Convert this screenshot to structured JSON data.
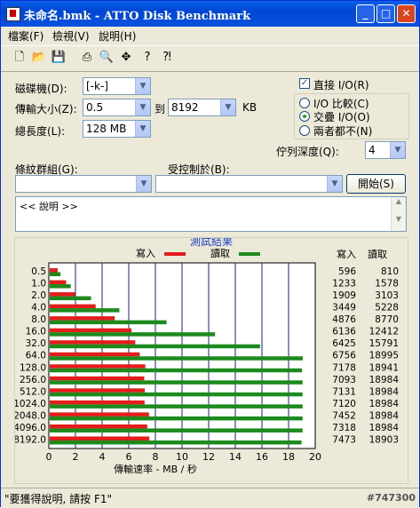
{
  "window": {
    "title": "未命名.bmk - ATTO Disk Benchmark",
    "minimize": "_",
    "maximize": "□",
    "close": "✕"
  },
  "menu": [
    "檔案(F)",
    "檢視(V)",
    "說明(H)"
  ],
  "toolbar": [
    "new-file-icon",
    "open-folder-icon",
    "save-icon",
    "print-icon",
    "print-preview-icon",
    "move-icon",
    "help-icon",
    "context-help-icon"
  ],
  "form": {
    "drive_label": "磁碟機(D):",
    "drive_value": "[-k-]",
    "transfer_label": "傳輸大小(Z):",
    "transfer_from": "0.5",
    "to_label": "到",
    "transfer_to": "8192",
    "kb_label": "KB",
    "length_label": "總長度(L):",
    "length_value": "128 MB",
    "direct_io_label": "直接 I/O(R)",
    "io_compare_label": "I/O 比較(C)",
    "overlap_io_label": "交疊 I/O(O)",
    "neither_label": "兩者都不(N)",
    "queue_label": "佇列深度(Q):",
    "queue_value": "4",
    "pattern_label": "條紋群組(G):",
    "pattern_value": "",
    "controlled_label": "受控制於(B):",
    "controlled_value": "",
    "start_button": "開始(S)",
    "description": "<< 說明 >>"
  },
  "chart_data": {
    "type": "bar",
    "title": "測試結果",
    "legend_write": "寫入",
    "legend_read": "讀取",
    "xlabel": "傳輸速率 - MB / 秒",
    "xlim": [
      0,
      20
    ],
    "xticks": [
      "0",
      "2",
      "4",
      "6",
      "8",
      "10",
      "12",
      "14",
      "16",
      "18",
      "20"
    ],
    "col_write": "寫入",
    "col_read": "讀取",
    "colors": {
      "write": "#e31c1c",
      "read": "#1c8a1c"
    },
    "categories": [
      "0.5",
      "1.0",
      "2.0",
      "4.0",
      "8.0",
      "16.0",
      "32.0",
      "64.0",
      "128.0",
      "256.0",
      "512.0",
      "1024.0",
      "2048.0",
      "4096.0",
      "8192.0"
    ],
    "series": [
      {
        "name": "寫入",
        "values": [
          596,
          1233,
          1909,
          3449,
          4876,
          6136,
          6425,
          6756,
          7178,
          7093,
          7131,
          7120,
          7452,
          7318,
          7473
        ]
      },
      {
        "name": "讀取",
        "values": [
          810,
          1578,
          3103,
          5228,
          8770,
          12412,
          15791,
          18995,
          18941,
          18984,
          18984,
          18984,
          18984,
          18984,
          18903
        ]
      }
    ]
  },
  "status": {
    "text": "\"要獲得說明, 請按 F1\"",
    "stamp": "#747300"
  }
}
